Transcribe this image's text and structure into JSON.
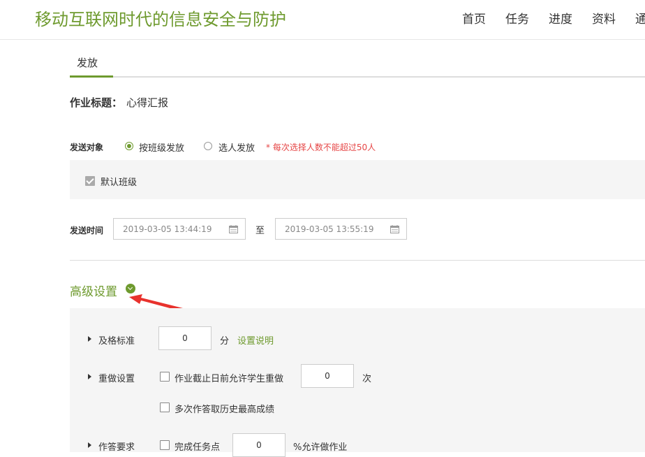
{
  "header": {
    "course_title": "移动互联网时代的信息安全与防护",
    "nav": [
      "首页",
      "任务",
      "进度",
      "资料",
      "通"
    ]
  },
  "tab": {
    "label": "发放"
  },
  "homework": {
    "title_label": "作业标题：",
    "title_value": "心得汇报"
  },
  "send_target": {
    "label": "发送对象",
    "option_class": "按班级发放",
    "option_person": "选人发放",
    "warning": "* 每次选择人数不能超过50人",
    "selected": "按班级发放",
    "default_class": "默认班级"
  },
  "send_time": {
    "label": "发送时间",
    "start": "2019-03-05 13:44:19",
    "to": "至",
    "end": "2019-03-05 13:55:19"
  },
  "advanced": {
    "title": "高级设置",
    "pass": {
      "label": "及格标准",
      "value": "0",
      "unit": "分",
      "help_link": "设置说明"
    },
    "redo": {
      "label": "重做设置",
      "option_redo": "作业截止日前允许学生重做",
      "redo_value": "0",
      "redo_unit": "次",
      "option_highest": "多次作答取历史最高成绩"
    },
    "answer": {
      "label": "作答要求",
      "option_task": "完成任务点",
      "task_value": "0",
      "task_suffix": "%允许做作业"
    }
  },
  "colors": {
    "brand": "#6e9a2e",
    "warning": "#e64545",
    "annotation_arrow": "#e8322d"
  }
}
